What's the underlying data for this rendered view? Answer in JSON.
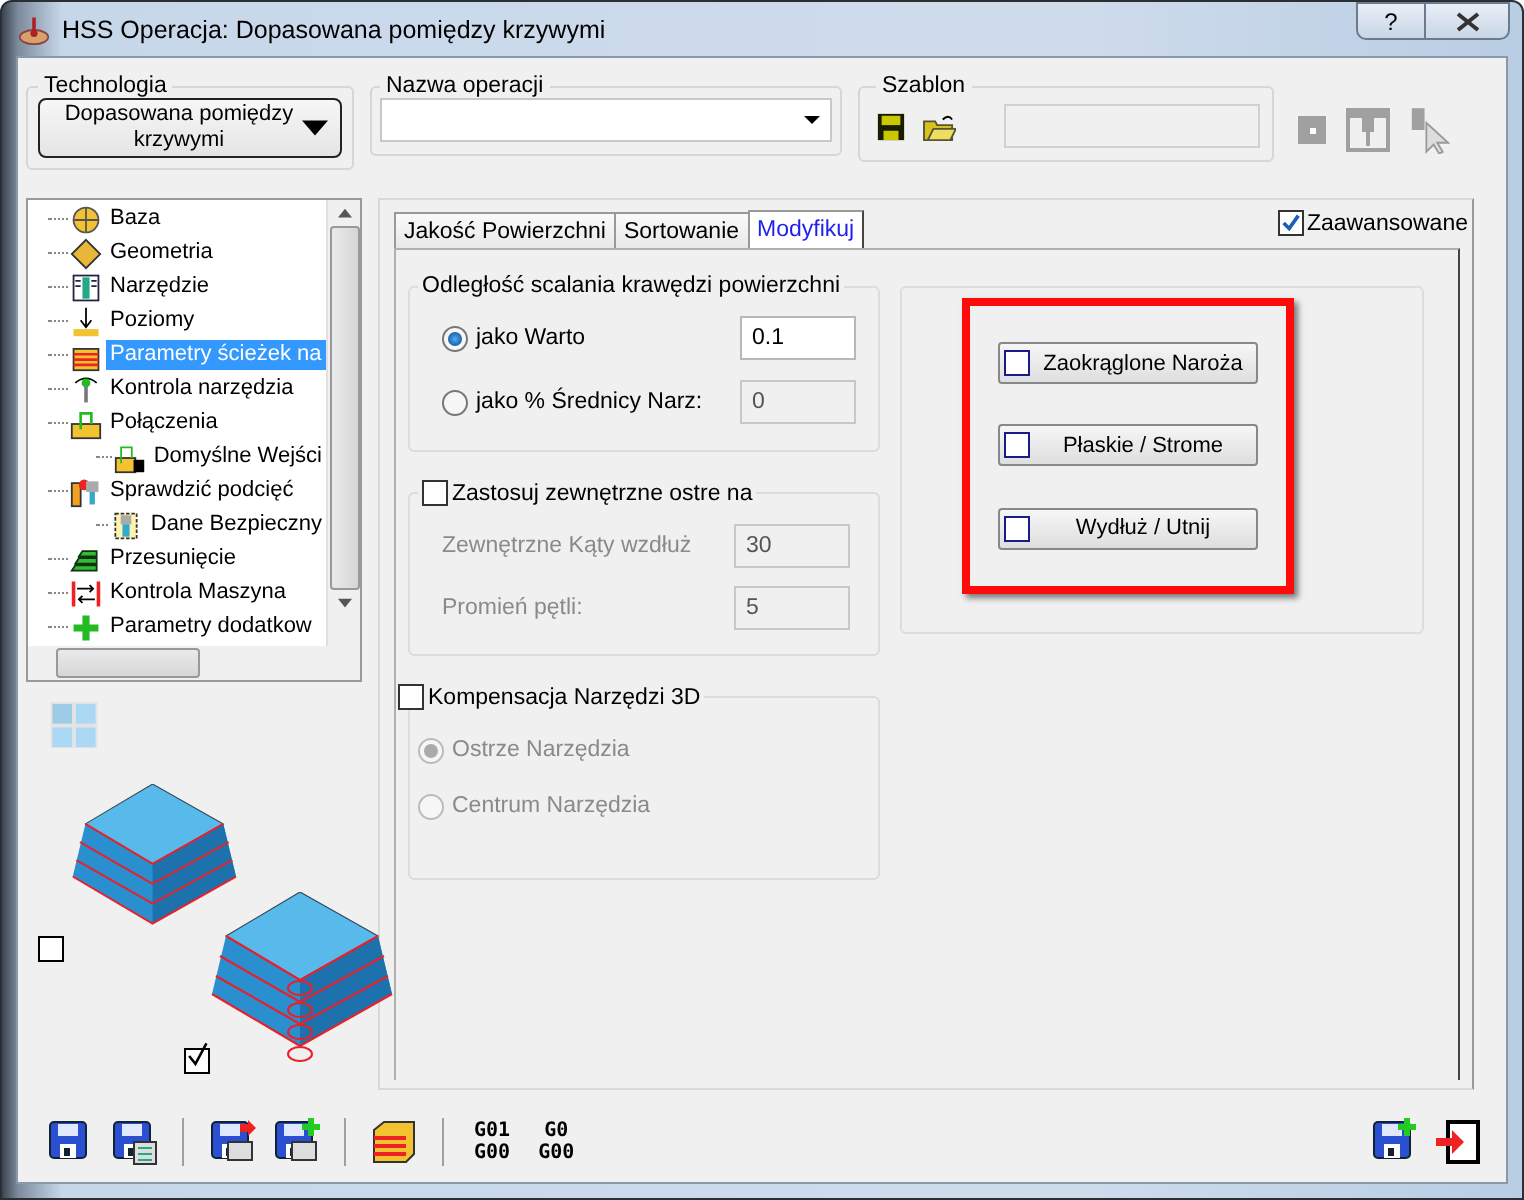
{
  "window": {
    "title": "HSS Operacja: Dopasowana pomiędzy krzywymi",
    "help": "?"
  },
  "technology": {
    "label": "Technologia",
    "value": "Dopasowana pomiędzy krzywymi"
  },
  "operation_name": {
    "label": "Nazwa operacji"
  },
  "template": {
    "label": "Szablon"
  },
  "tree": {
    "items": [
      {
        "label": "Baza",
        "selected": false
      },
      {
        "label": "Geometria",
        "selected": false
      },
      {
        "label": "Narzędzie",
        "selected": false
      },
      {
        "label": "Poziomy",
        "selected": false
      },
      {
        "label": "Parametry ścieżek na",
        "selected": true
      },
      {
        "label": "Kontrola narzędzia",
        "selected": false
      },
      {
        "label": "Połączenia",
        "selected": false,
        "children": [
          {
            "label": "Domyślne Wejści",
            "selected": false
          }
        ]
      },
      {
        "label": "Sprawdzić podcięć",
        "selected": false,
        "children": [
          {
            "label": "Dane Bezpieczny",
            "selected": false
          }
        ]
      },
      {
        "label": "Przesunięcie",
        "selected": false
      },
      {
        "label": "Kontrola Maszyna",
        "selected": false
      },
      {
        "label": "Parametry dodatkow",
        "selected": false
      }
    ]
  },
  "preview": [
    {
      "checked": false
    },
    {
      "checked": true
    }
  ],
  "advanced": {
    "label": "Zaawansowane",
    "checked": true
  },
  "tabs": [
    {
      "label": "Jakość Powierzchni",
      "selected": false
    },
    {
      "label": "Sortowanie",
      "selected": false
    },
    {
      "label": "Modyfikuj",
      "selected": true
    }
  ],
  "merge_group": {
    "title": "Odległość scalania krawędzi powierzchni",
    "options": [
      {
        "label": "jako Warto",
        "selected": true,
        "value": "0.1",
        "disabled": false
      },
      {
        "label": "jako % Średnicy Narz:",
        "selected": false,
        "value": "0",
        "disabled": true
      }
    ]
  },
  "sharp_group": {
    "title": "Zastosuj zewnętrzne ostre na",
    "checked": false,
    "fields": [
      {
        "label": "Zewnętrzne Kąty wzdłuż",
        "value": "30"
      },
      {
        "label": "Promień pętli:",
        "value": "5"
      }
    ]
  },
  "compensation_group": {
    "title": "Kompensacja Narzędzi 3D",
    "checked": false,
    "options": [
      {
        "label": "Ostrze Narzędzia",
        "selected": true
      },
      {
        "label": "Centrum Narzędzia",
        "selected": false
      }
    ]
  },
  "modifiers": [
    {
      "label": "Zaokrąglone Naroża",
      "checked": false
    },
    {
      "label": "Płaskie / Strome",
      "checked": false
    },
    {
      "label": "Wydłuż / Utnij",
      "checked": false
    }
  ],
  "gcode_buttons": [
    {
      "lines": [
        "G01",
        "G00"
      ]
    },
    {
      "lines": [
        "G0",
        "G00"
      ]
    }
  ]
}
